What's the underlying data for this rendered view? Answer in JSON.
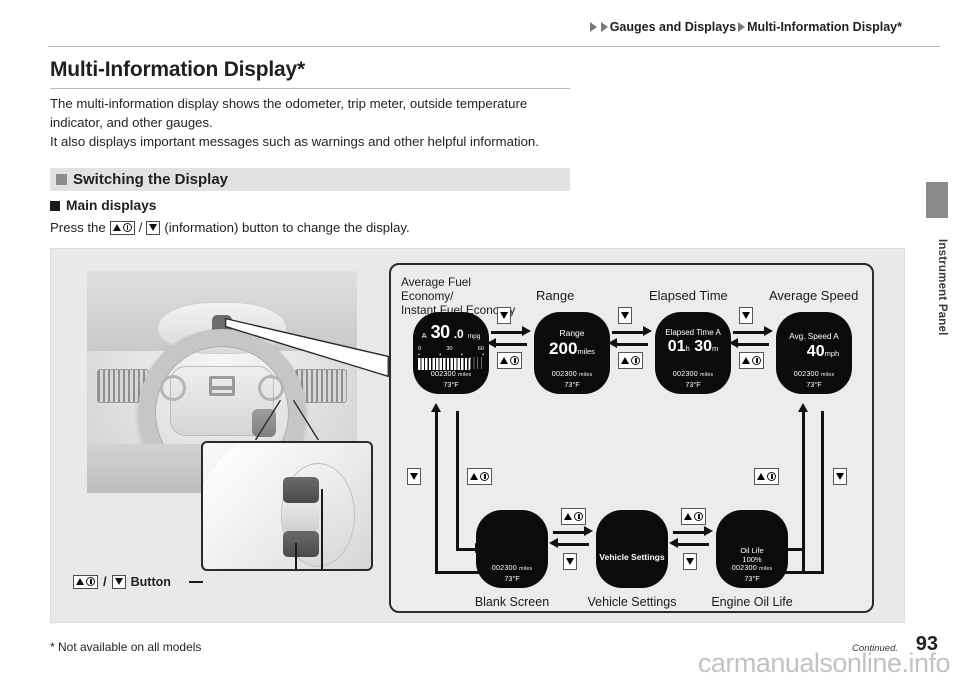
{
  "breadcrumb": {
    "item1": "Gauges and Displays",
    "item2": "Multi-Information Display*"
  },
  "page_title": "Multi-Information Display*",
  "intro": {
    "line1": "The multi-information display shows the odometer, trip meter, outside temperature indicator, and other gauges.",
    "line2": "It also displays important messages such as warnings and other helpful information."
  },
  "section": {
    "heading": "Switching the Display"
  },
  "subsection": {
    "heading": "Main displays"
  },
  "press_instruction": {
    "before": "Press the",
    "after": "(information) button to change the display."
  },
  "figure": {
    "button_label": "Button",
    "column_labels": {
      "fuel_economy": "Average Fuel Economy/\nInstant Fuel Economy",
      "range": "Range",
      "elapsed_time": "Elapsed Time",
      "average_speed": "Average Speed"
    },
    "displays": {
      "fuel_economy": {
        "trip_letter": "A",
        "value": "30",
        "decimal": ".0",
        "unit": "mpg",
        "scale_min": "0",
        "scale_mid": "30",
        "scale_max": "60",
        "odometer": "002300",
        "odometer_unit": "miles",
        "temperature": "73°F"
      },
      "range": {
        "title": "Range",
        "value": "200",
        "unit": "miles",
        "odometer": "002300",
        "odometer_unit": "miles",
        "temperature": "73°F"
      },
      "elapsed_time": {
        "title": "Elapsed Time A",
        "hours": "01",
        "hours_unit": "h",
        "minutes": "30",
        "minutes_unit": "m",
        "odometer": "002300",
        "odometer_unit": "miles",
        "temperature": "73°F"
      },
      "average_speed": {
        "title": "Avg. Speed A",
        "value": "40",
        "unit": "mph",
        "odometer": "002300",
        "odometer_unit": "miles",
        "temperature": "73°F"
      },
      "blank_screen": {
        "caption": "Blank Screen",
        "odometer": "002300",
        "odometer_unit": "miles",
        "temperature": "73°F"
      },
      "vehicle_settings": {
        "title": "Vehicle Settings",
        "caption": "Vehicle Settings"
      },
      "engine_oil_life": {
        "title": "Oil Life",
        "value": "100%",
        "caption": "Engine Oil Life",
        "odometer": "002300",
        "odometer_unit": "miles",
        "temperature": "73°F"
      }
    }
  },
  "side_tab": {
    "label": "Instrument Panel"
  },
  "footer": {
    "footnote": "* Not available on all models",
    "continued": "Continued.",
    "page_number": "93",
    "watermark": "carmanualsonline.info"
  },
  "colors": {
    "text": "#231f20",
    "band": "#e2e2e2",
    "figure_bg": "#e9e9e9",
    "display_bg": "#0b0b0b",
    "tab": "#8a8a8a"
  }
}
